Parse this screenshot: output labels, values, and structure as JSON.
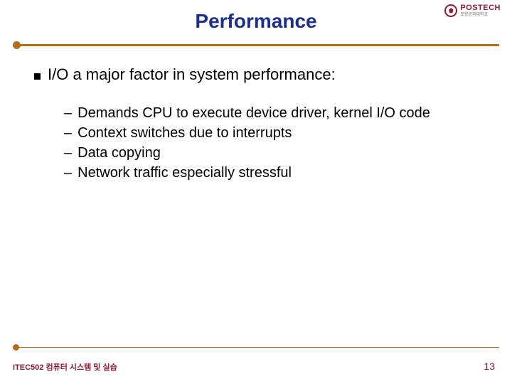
{
  "title": "Performance",
  "logo": {
    "main": "POSTECH",
    "sub": "포항공과대학교"
  },
  "main_bullet": "I/O a major factor in system performance:",
  "sub_bullets": [
    "Demands CPU to execute device driver, kernel I/O code",
    "Context switches due to interrupts",
    "Data copying",
    "Network traffic especially stressful"
  ],
  "footer": {
    "course": "ITEC502 컴퓨터 시스템 및 실습",
    "page": "13"
  }
}
